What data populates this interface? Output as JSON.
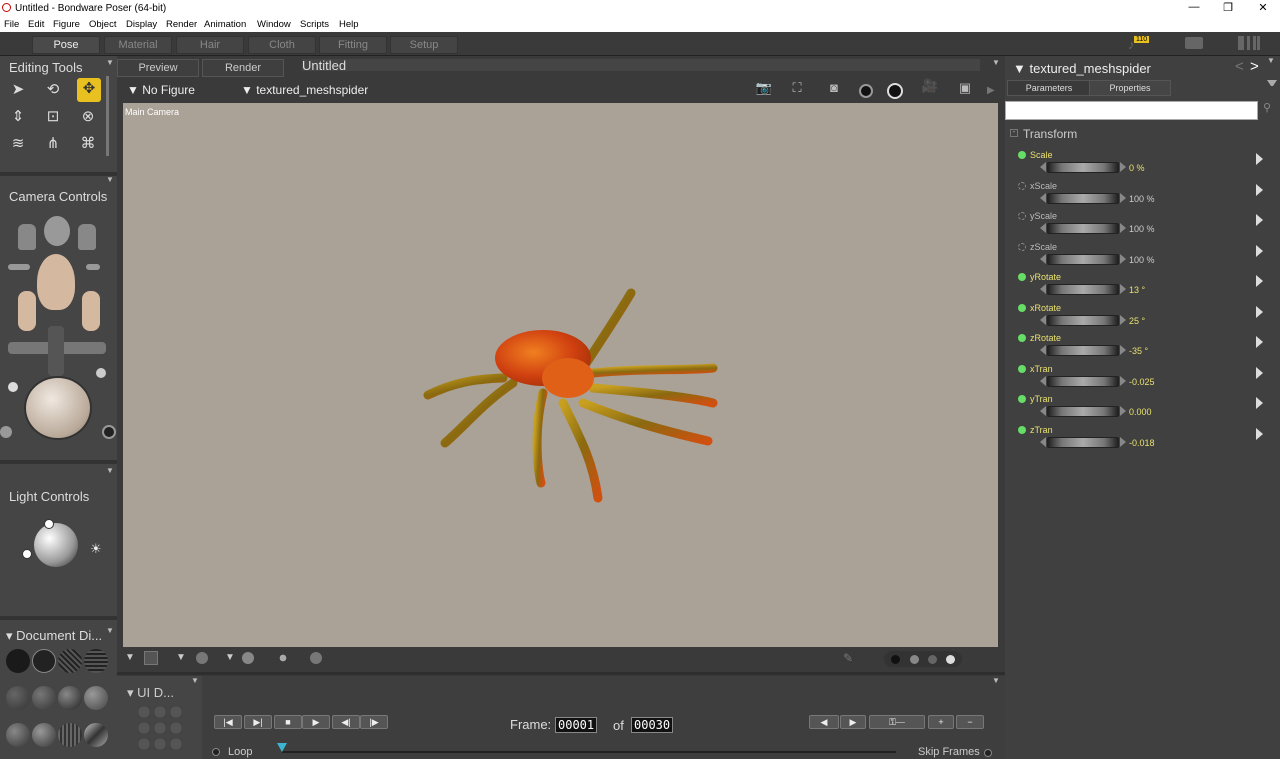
{
  "window": {
    "title": "Untitled - Bondware Poser (64-bit)"
  },
  "menu": [
    "File",
    "Edit",
    "Figure",
    "Object",
    "Display",
    "Render",
    "Animation",
    "Window",
    "Scripts",
    "Help"
  ],
  "rooms": [
    "Pose",
    "Material",
    "Hair",
    "Cloth",
    "Fitting",
    "Setup"
  ],
  "notification_count": "110",
  "left": {
    "editing_tools": "Editing Tools",
    "camera_controls": "Camera Controls",
    "light_controls": "Light Controls",
    "document_display": "Document Di...",
    "ui_dots": "UI D..."
  },
  "doc": {
    "tab_preview": "Preview",
    "tab_render": "Render",
    "doc_title": "Untitled",
    "figure_select": "No Figure",
    "actor_select": "textured_meshspider",
    "camera_label": "Main Camera"
  },
  "timeline": {
    "frame_label": "Frame:",
    "current_frame": "00001",
    "of_label": "of",
    "total_frames": "00030",
    "loop_label": "Loop",
    "skip_frames_label": "Skip Frames"
  },
  "right": {
    "title": "textured_meshspider",
    "tab_parameters": "Parameters",
    "tab_properties": "Properties",
    "search_placeholder": "",
    "group": "Transform",
    "params": [
      {
        "name": "Scale",
        "value": "0 %",
        "active": true
      },
      {
        "name": "xScale",
        "value": "100 %",
        "active": false
      },
      {
        "name": "yScale",
        "value": "100 %",
        "active": false
      },
      {
        "name": "zScale",
        "value": "100 %",
        "active": false
      },
      {
        "name": "yRotate",
        "value": "13 °",
        "active": true
      },
      {
        "name": "xRotate",
        "value": "25 °",
        "active": true
      },
      {
        "name": "zRotate",
        "value": "-35 °",
        "active": true
      },
      {
        "name": "xTran",
        "value": "-0.025",
        "active": true
      },
      {
        "name": "yTran",
        "value": "0.000",
        "active": true
      },
      {
        "name": "zTran",
        "value": "-0.018",
        "active": true
      }
    ]
  },
  "colors": {
    "accent": "#e8c020",
    "active_dot": "#66dd66",
    "param_name": "#e8e070",
    "viewport_bg": "#aaa297"
  }
}
